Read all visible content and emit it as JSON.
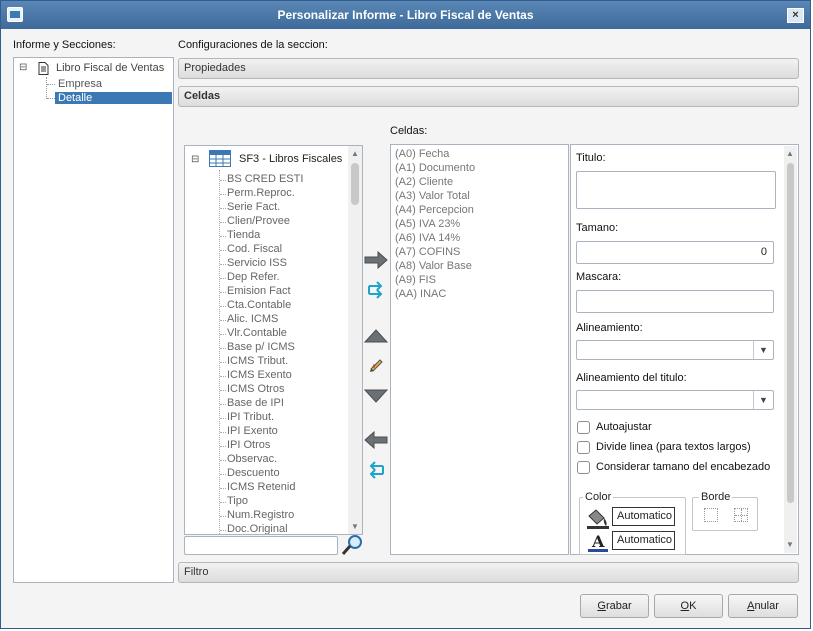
{
  "window": {
    "title": "Personalizar Informe - Libro Fiscal de Ventas",
    "close": "×"
  },
  "left": {
    "header": "Informe y Secciones:",
    "tree": {
      "root": "Libro Fiscal de Ventas",
      "expander": "⊟",
      "children": [
        "Empresa",
        "Detalle"
      ],
      "selected": "Detalle"
    }
  },
  "config": {
    "header": "Configuraciones de la seccion:",
    "sections": {
      "propiedades": "Propiedades",
      "celdas": "Celdas",
      "filtro": "Filtro"
    }
  },
  "fields": {
    "expander": "⊟",
    "root": "SF3 - Libros Fiscales",
    "items": [
      "BS CRED ESTI",
      "Perm.Reproc.",
      "Serie Fact.",
      "Clien/Provee",
      "Tienda",
      "Cod. Fiscal",
      "Servicio ISS",
      "Dep Refer.",
      "Emision Fact",
      "Cta.Contable",
      "Alic. ICMS",
      "Vlr.Contable",
      "Base p/ ICMS",
      "ICMS Tribut.",
      "ICMS Exento",
      "ICMS Otros",
      "Base de IPI",
      "IPI Tribut.",
      "IPI Exento",
      "IPI Otros",
      "Observac.",
      "Descuento",
      "ICMS Retenid",
      "Tipo",
      "Num.Registro",
      "Doc.Original"
    ],
    "search_value": ""
  },
  "cells": {
    "header": "Celdas:",
    "items": [
      "(A0) Fecha",
      "(A1) Documento",
      "(A2) Cliente",
      "(A3) Valor Total",
      "(A4) Percepcion",
      "(A5) IVA 23%",
      "(A6) IVA 14%",
      "(A7) COFINS",
      "(A8) Valor Base",
      "(A9) FIS",
      "(AA) INAC"
    ]
  },
  "props": {
    "titulo_label": "Titulo:",
    "titulo_value": "",
    "tamano_label": "Tamano:",
    "tamano_value": "0",
    "mascara_label": "Mascara:",
    "mascara_value": "",
    "alineamiento_label": "Alineamiento:",
    "alineamiento_value": "",
    "alineamiento_titulo_label": "Alineamiento del titulo:",
    "alineamiento_titulo_value": "",
    "autoajustar": "Autoajustar",
    "divide_linea": "Divide linea (para textos largos)",
    "considerar": "Considerar tamano del encabezado",
    "color_label": "Color",
    "color_fill": "Automatico",
    "color_text": "Automatico",
    "borde_label": "Borde"
  },
  "buttons": {
    "grabar": "Grabar",
    "ok": "OK",
    "anular": "Anular"
  },
  "colors": {
    "titlebar": "#4a78a8",
    "selection": "#3c78b4",
    "arrow_gray": "#6b7075",
    "arrow_teal": "#1fa3c8"
  }
}
